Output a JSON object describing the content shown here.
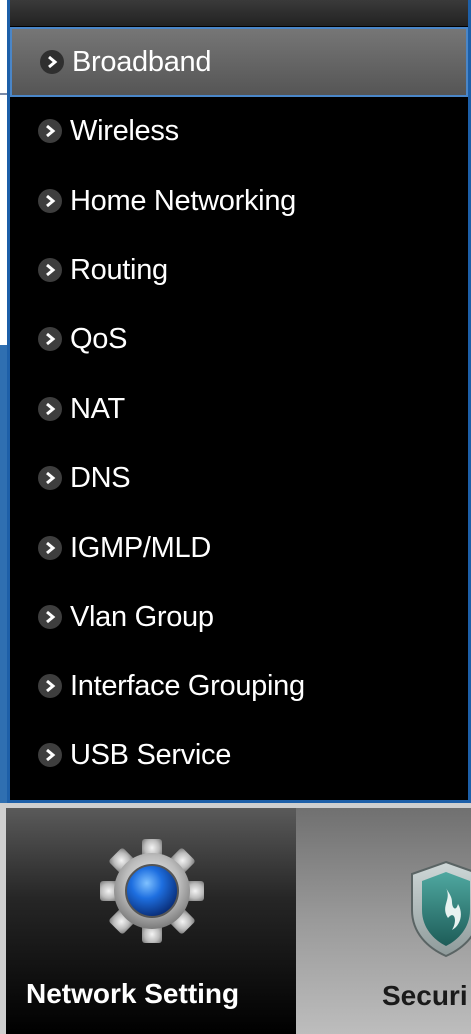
{
  "menu": {
    "items": [
      {
        "label": "Broadband",
        "active": true
      },
      {
        "label": "Wireless",
        "active": false
      },
      {
        "label": "Home Networking",
        "active": false
      },
      {
        "label": "Routing",
        "active": false
      },
      {
        "label": "QoS",
        "active": false
      },
      {
        "label": "NAT",
        "active": false
      },
      {
        "label": "DNS",
        "active": false
      },
      {
        "label": "IGMP/MLD",
        "active": false
      },
      {
        "label": "Vlan Group",
        "active": false
      },
      {
        "label": "Interface Grouping",
        "active": false
      },
      {
        "label": "USB Service",
        "active": false
      }
    ],
    "icon": "chevron-right-icon"
  },
  "tabs": [
    {
      "label": "Network Setting",
      "icon": "gear-icon",
      "selected": true
    },
    {
      "label": "Securi",
      "icon": "shield-icon",
      "selected": false
    }
  ],
  "colors": {
    "menu_background": "#000000",
    "menu_border": "#1d5fa8",
    "active_item": "#6a6a6a",
    "text": "#ffffff"
  }
}
